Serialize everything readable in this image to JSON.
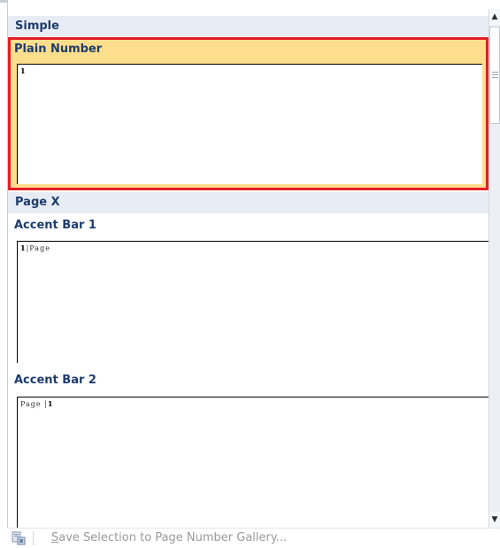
{
  "gallery": {
    "sections": [
      {
        "label": "Simple"
      },
      {
        "label": "Page X"
      }
    ],
    "items": [
      {
        "label": "Plain Number",
        "preview_number": "1",
        "preview_suffix": "",
        "preview_prefix": ""
      },
      {
        "label": "Accent Bar 1",
        "preview_number": "1",
        "preview_suffix": "|Page",
        "preview_prefix": ""
      },
      {
        "label": "Accent Bar 2",
        "preview_number": "1",
        "preview_suffix": "",
        "preview_prefix": "Page |"
      }
    ],
    "selected_item": "Plain Number"
  },
  "footer": {
    "save_label_accel": "S",
    "save_label_rest": "ave Selection to Page Number Gallery..."
  },
  "colors": {
    "selected_fill": "#fdde8c",
    "selected_border": "#e41e25",
    "header_text": "#1e3c6e",
    "section_bg": "#e8edf5"
  },
  "icons": {
    "scroll_up": "triangle-up-icon",
    "scroll_down": "triangle-down-icon",
    "footer": "save-to-gallery-icon"
  }
}
